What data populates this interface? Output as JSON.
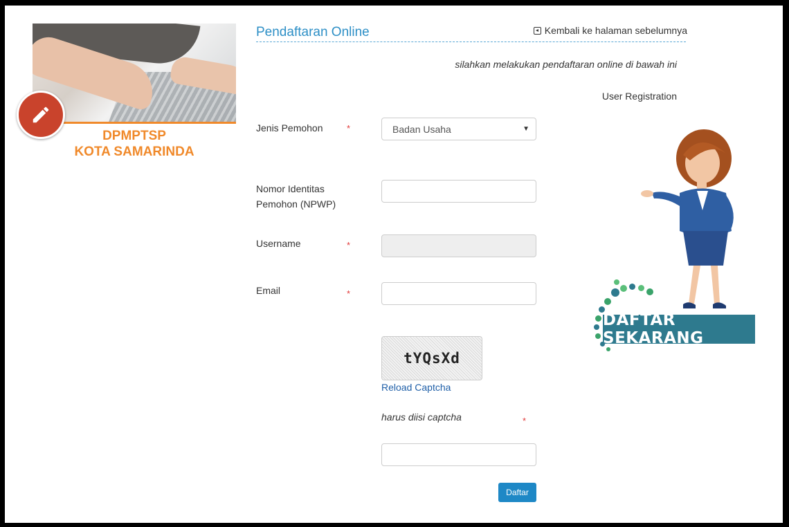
{
  "brand": {
    "line1": "DPMPTSP",
    "line2": "KOTA SAMARINDA",
    "badge_icon": "pencil-icon",
    "accent_color": "#f0892a"
  },
  "header": {
    "title": "Pendaftaran Online",
    "back_link": "Kembali ke halaman sebelumnya",
    "subtitle": "silahkan melakukan pendaftaran online di bawah ini",
    "section_heading": "User Registration"
  },
  "form": {
    "jenis_label": "Jenis Pemohon",
    "jenis_value": "Badan Usaha",
    "npwp_label_1": "Nomor Identitas",
    "npwp_label_2": "Pemohon (NPWP)",
    "npwp_value": "",
    "username_label": "Username",
    "username_value": "",
    "email_label": "Email",
    "email_value": "",
    "required_mark": "*",
    "captcha_text": "tYQsXd",
    "reload_captcha": "Reload Captcha",
    "captcha_note": "harus diisi captcha",
    "captcha_value": "",
    "submit_label": "Daftar"
  },
  "illustration": {
    "banner_text": "DAFTAR SEKARANG"
  },
  "colors": {
    "link_blue": "#2d8fc6",
    "button_blue": "#1e88c6",
    "required_red": "#e23a3a"
  }
}
